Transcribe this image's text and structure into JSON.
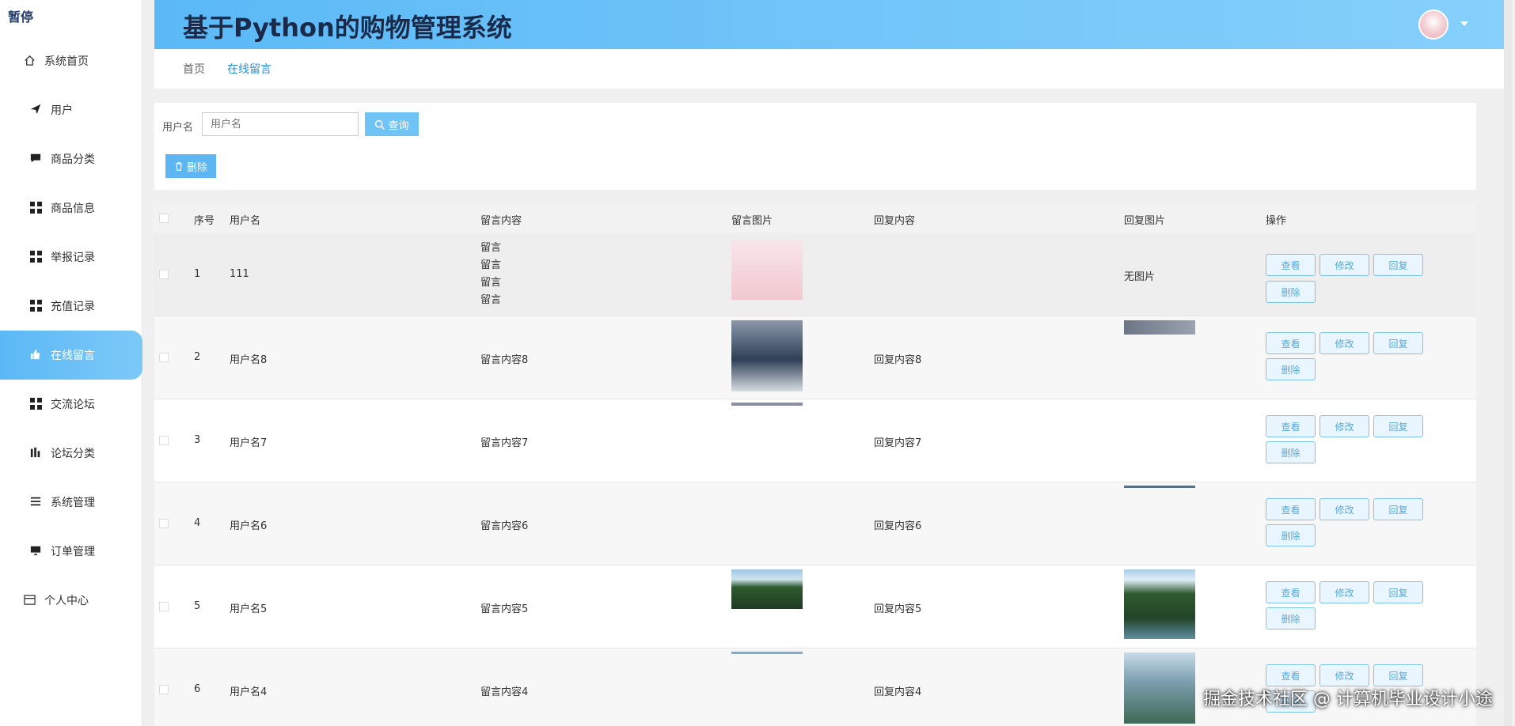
{
  "brand": "暂停",
  "app_title": "基于Python的购物管理系统",
  "sidebar": {
    "items": [
      {
        "label": "系统首页",
        "icon": "home-icon"
      },
      {
        "label": "用户",
        "icon": "send-icon"
      },
      {
        "label": "商品分类",
        "icon": "chat-icon"
      },
      {
        "label": "商品信息",
        "icon": "grid-icon"
      },
      {
        "label": "举报记录",
        "icon": "grid-icon"
      },
      {
        "label": "充值记录",
        "icon": "grid-icon"
      },
      {
        "label": "在线留言",
        "icon": "thumb-icon",
        "active": true
      },
      {
        "label": "交流论坛",
        "icon": "grid-icon"
      },
      {
        "label": "论坛分类",
        "icon": "chart-icon"
      },
      {
        "label": "系统管理",
        "icon": "list-icon"
      },
      {
        "label": "订单管理",
        "icon": "monitor-icon"
      },
      {
        "label": "个人中心",
        "icon": "card-icon"
      }
    ]
  },
  "breadcrumb": {
    "home": "首页",
    "current": "在线留言"
  },
  "filter": {
    "label": "用户名",
    "placeholder": "用户名",
    "search": "查询",
    "delete": "删除"
  },
  "table": {
    "headers": {
      "index": "序号",
      "username": "用户名",
      "content": "留言内容",
      "image": "留言图片",
      "reply": "回复内容",
      "reply_image": "回复图片",
      "ops": "操作"
    },
    "rows": [
      {
        "index": "1",
        "username": "111",
        "content": [
          "留言",
          "留言",
          "留言",
          "留言"
        ],
        "reply": "",
        "reply_image_text": "无图片"
      },
      {
        "index": "2",
        "username": "用户名8",
        "content": [
          "留言内容8"
        ],
        "reply": "回复内容8",
        "reply_image_text": ""
      },
      {
        "index": "3",
        "username": "用户名7",
        "content": [
          "留言内容7"
        ],
        "reply": "回复内容7",
        "reply_image_text": ""
      },
      {
        "index": "4",
        "username": "用户名6",
        "content": [
          "留言内容6"
        ],
        "reply": "回复内容6",
        "reply_image_text": ""
      },
      {
        "index": "5",
        "username": "用户名5",
        "content": [
          "留言内容5"
        ],
        "reply": "回复内容5",
        "reply_image_text": ""
      },
      {
        "index": "6",
        "username": "用户名4",
        "content": [
          "留言内容4"
        ],
        "reply": "回复内容4",
        "reply_image_text": ""
      }
    ],
    "ops": {
      "view": "查看",
      "edit": "修改",
      "reply": "回复",
      "delete": "删除"
    }
  },
  "watermark": "掘金技术社区 @ 计算机毕业设计小途"
}
